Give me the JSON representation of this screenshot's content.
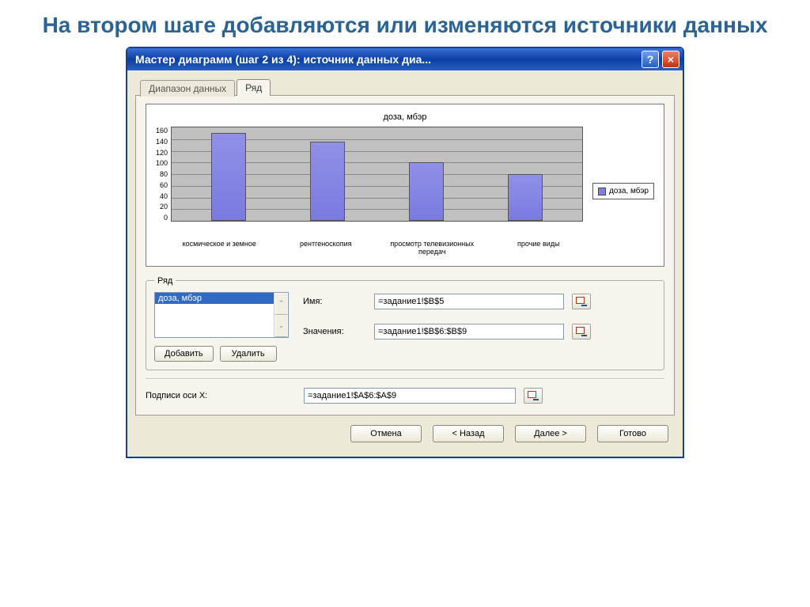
{
  "slide": {
    "title": "На втором шаге добавляются или изменяются источники данных"
  },
  "window": {
    "title": "Мастер диаграмм (шаг 2 из 4): источник данных диа...",
    "help_symbol": "?",
    "close_symbol": "×"
  },
  "tabs": {
    "data_range": "Диапазон данных",
    "series": "Ряд"
  },
  "chart_data": {
    "type": "bar",
    "title": "доза, мбэр",
    "categories": [
      "космическое и земное",
      "рентгеноскопия",
      "просмотр телевизионных передач",
      "прочие виды"
    ],
    "values": [
      150,
      135,
      100,
      80
    ],
    "legend": "доза, мбэр",
    "ylim": [
      0,
      160
    ],
    "yticks": [
      0,
      20,
      40,
      60,
      80,
      100,
      120,
      140,
      160
    ]
  },
  "series_box": {
    "legend": "Ряд",
    "selected_item": "доза, мбэр",
    "spin_up": "⌃",
    "spin_down": "⌄",
    "name_label": "Имя:",
    "values_label": "Значения:",
    "name_value": "=задание1!$B$5",
    "values_value": "=задание1!$B$6:$B$9",
    "add_btn": "Добавить",
    "remove_btn": "Удалить"
  },
  "xaxis": {
    "label": "Подписи оси X:",
    "value": "=задание1!$A$6:$A$9"
  },
  "buttons": {
    "cancel": "Отмена",
    "back": "< Назад",
    "next": "Далее >",
    "finish": "Готово"
  }
}
